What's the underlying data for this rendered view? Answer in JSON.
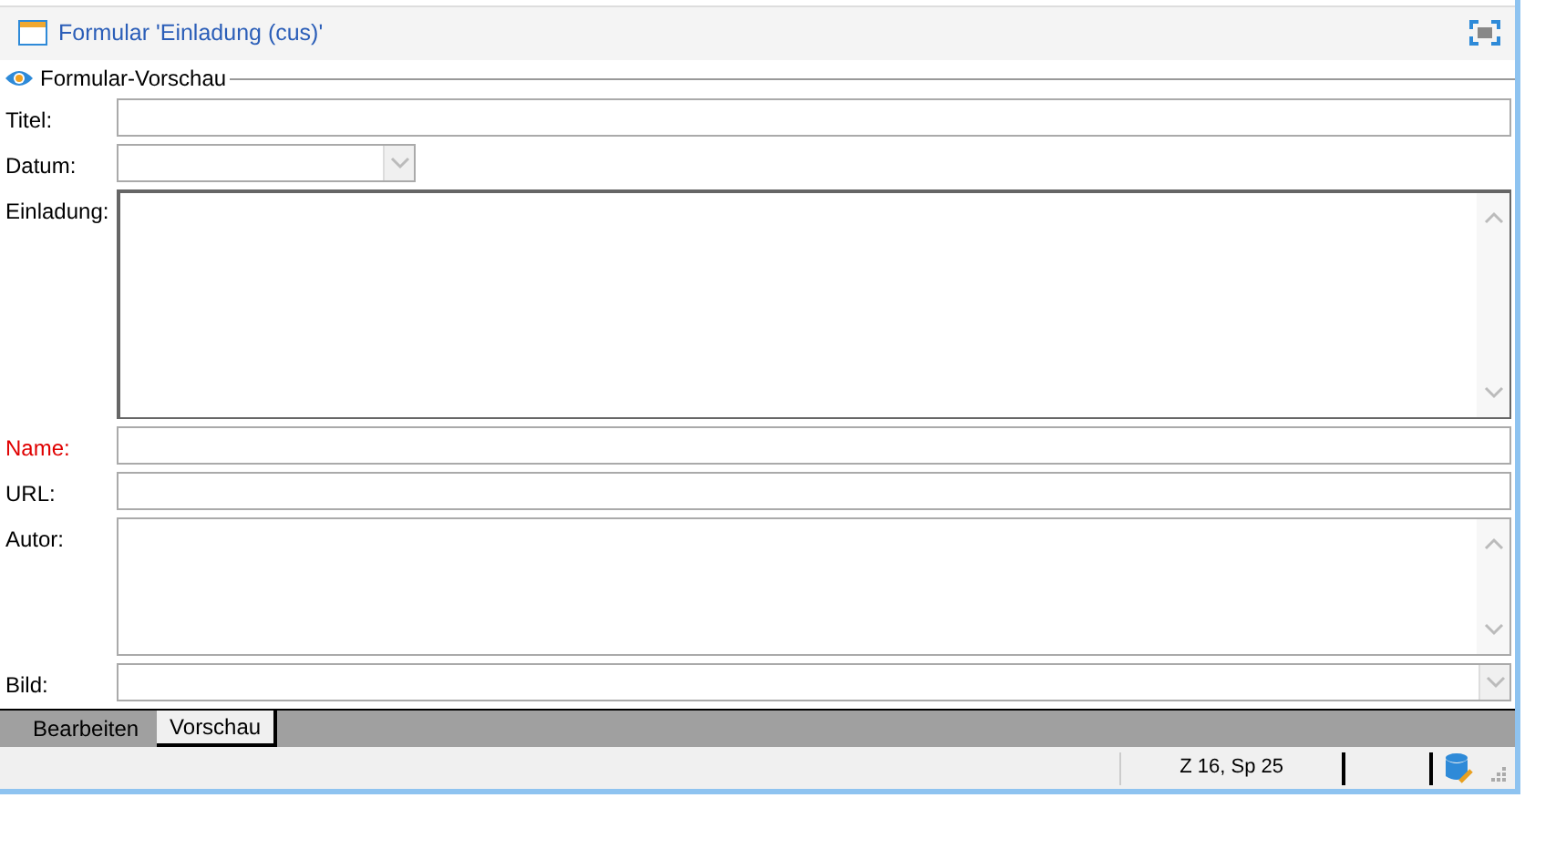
{
  "window": {
    "title": "Formular 'Einladung (cus)'"
  },
  "group": {
    "label": "Formular-Vorschau"
  },
  "fields": [
    {
      "label": "Titel:",
      "kind": "text",
      "required": false,
      "focused": false
    },
    {
      "label": "Datum:",
      "kind": "date",
      "required": false,
      "focused": false
    },
    {
      "label": "Einladung:",
      "kind": "memo",
      "required": false,
      "focused": true
    },
    {
      "label": "Name:",
      "kind": "text",
      "required": true,
      "focused": false
    },
    {
      "label": "URL:",
      "kind": "text",
      "required": false,
      "focused": false
    },
    {
      "label": "Autor:",
      "kind": "memo",
      "required": false,
      "focused": false
    },
    {
      "label": "Bild:",
      "kind": "dropdown",
      "required": false,
      "focused": false
    }
  ],
  "tabs": [
    {
      "label": "Bearbeiten",
      "selected": false
    },
    {
      "label": "Vorschau",
      "selected": true
    }
  ],
  "status_bar": {
    "position": "Z 16, Sp 25"
  }
}
